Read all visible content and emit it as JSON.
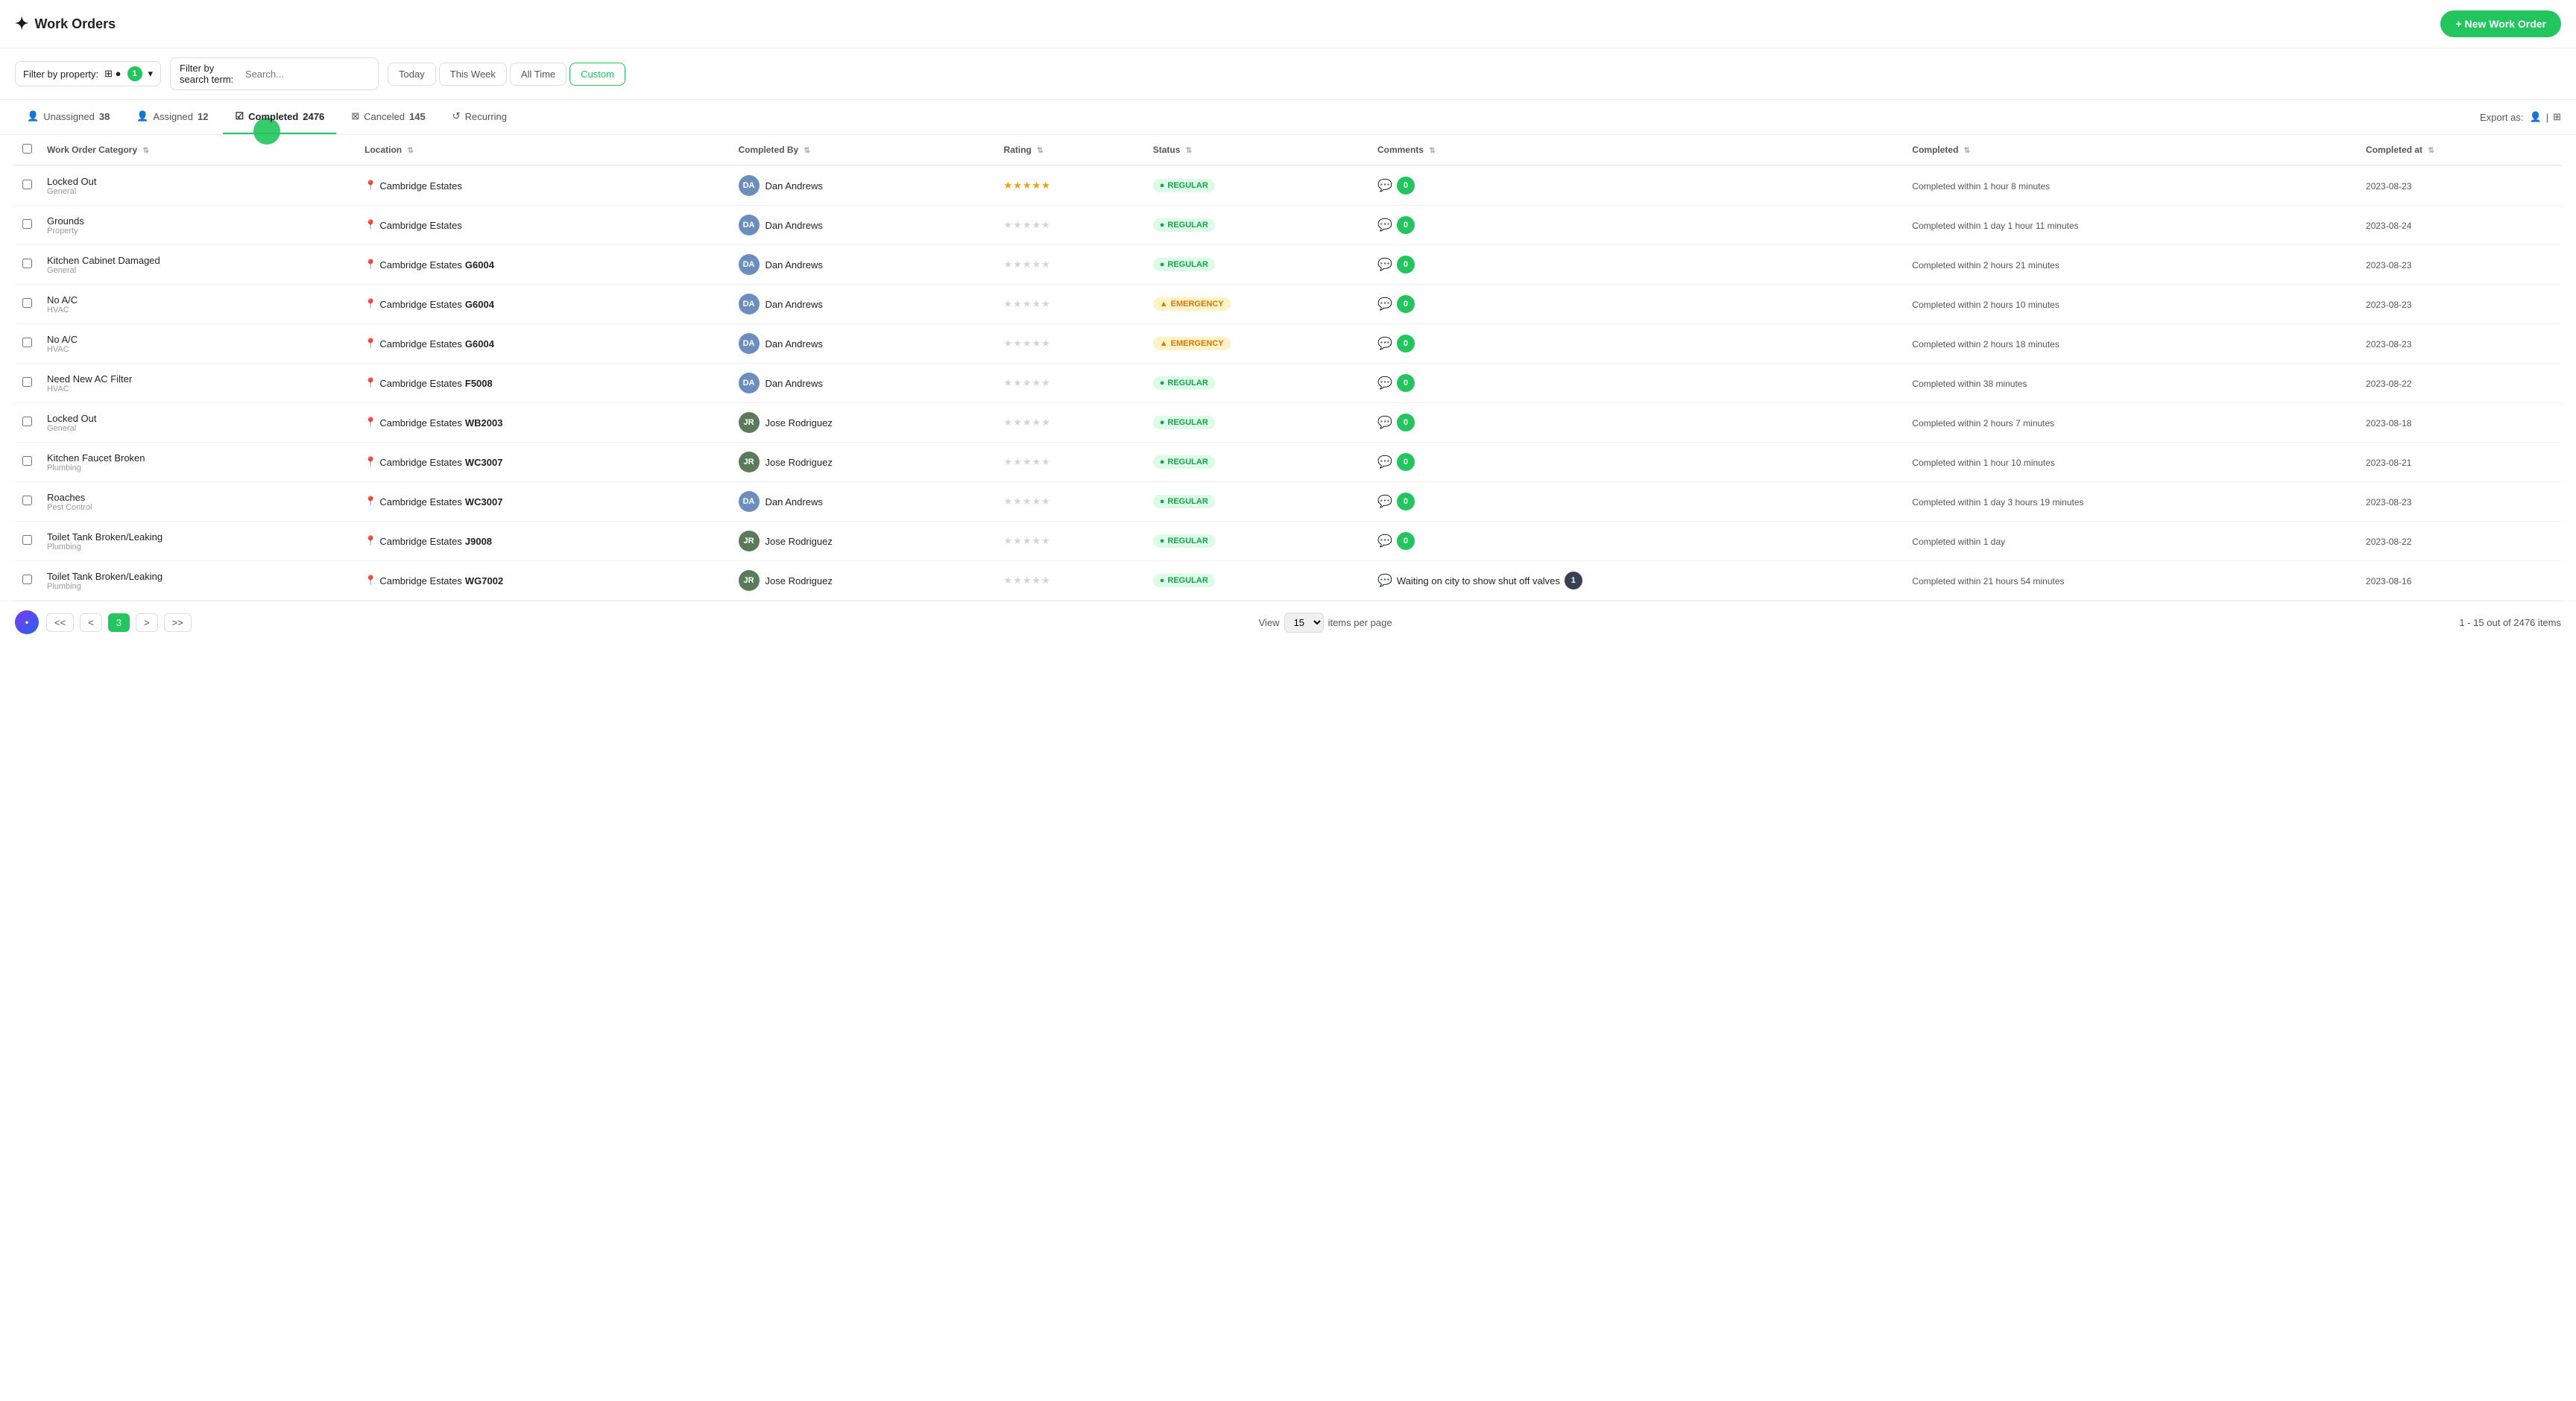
{
  "app": {
    "title": "Work Orders",
    "new_work_order_btn": "+ New Work Order"
  },
  "filter_bar": {
    "filter_property_label": "Filter by property:",
    "filter_count": "1",
    "search_label": "Filter by search term:",
    "search_placeholder": "Search...",
    "date_filters": [
      {
        "label": "Today",
        "active": false
      },
      {
        "label": "This Week",
        "active": false
      },
      {
        "label": "All Time",
        "active": false
      },
      {
        "label": "Custom",
        "active": true
      }
    ]
  },
  "tabs": [
    {
      "label": "Unassigned",
      "count": "38",
      "icon": "person"
    },
    {
      "label": "Assigned",
      "count": "12",
      "icon": "person"
    },
    {
      "label": "Completed",
      "count": "2476",
      "icon": "check",
      "active": true
    },
    {
      "label": "Canceled",
      "count": "145",
      "icon": "x"
    },
    {
      "label": "Recurring",
      "count": "",
      "icon": "refresh"
    }
  ],
  "export": {
    "label": "Export as:"
  },
  "table": {
    "columns": [
      {
        "label": "Work Order Category",
        "sortable": true
      },
      {
        "label": "Location",
        "sortable": true
      },
      {
        "label": "Completed By",
        "sortable": true
      },
      {
        "label": "Rating",
        "sortable": true
      },
      {
        "label": "Status",
        "sortable": true
      },
      {
        "label": "Comments",
        "sortable": true
      },
      {
        "label": "Completed",
        "sortable": true
      },
      {
        "label": "Completed at",
        "sortable": true
      }
    ],
    "rows": [
      {
        "category": "Locked Out",
        "subcategory": "General",
        "location": "Cambridge Estates",
        "location_unit": "",
        "completed_by": "Dan Andrews",
        "avatar_initials": "DA",
        "avatar_class": "avatar-da",
        "rating": 5,
        "status": "REGULAR",
        "status_type": "regular",
        "comment_count": "0",
        "comment_has_text": false,
        "completed": "Completed within 1 hour 8 minutes",
        "completed_at": "2023-08-23"
      },
      {
        "category": "Grounds",
        "subcategory": "Property",
        "location": "Cambridge Estates",
        "location_unit": "",
        "completed_by": "Dan Andrews",
        "avatar_initials": "DA",
        "avatar_class": "avatar-da",
        "rating": 0,
        "status": "REGULAR",
        "status_type": "regular",
        "comment_count": "0",
        "comment_has_text": false,
        "completed": "Completed within 1 day 1 hour 11 minutes",
        "completed_at": "2023-08-24"
      },
      {
        "category": "Kitchen Cabinet Damaged",
        "subcategory": "General",
        "location": "Cambridge Estates",
        "location_unit": "G6004",
        "completed_by": "Dan Andrews",
        "avatar_initials": "DA",
        "avatar_class": "avatar-da",
        "rating": 0,
        "status": "REGULAR",
        "status_type": "regular",
        "comment_count": "0",
        "comment_has_text": false,
        "completed": "Completed within 2 hours 21 minutes",
        "completed_at": "2023-08-23"
      },
      {
        "category": "No A/C",
        "subcategory": "HVAC",
        "location": "Cambridge Estates",
        "location_unit": "G6004",
        "completed_by": "Dan Andrews",
        "avatar_initials": "DA",
        "avatar_class": "avatar-da",
        "rating": 0,
        "status": "EMERGENCY",
        "status_type": "emergency",
        "comment_count": "0",
        "comment_has_text": false,
        "completed": "Completed within 2 hours 10 minutes",
        "completed_at": "2023-08-23"
      },
      {
        "category": "No A/C",
        "subcategory": "HVAC",
        "location": "Cambridge Estates",
        "location_unit": "G6004",
        "completed_by": "Dan Andrews",
        "avatar_initials": "DA",
        "avatar_class": "avatar-da",
        "rating": 0,
        "status": "EMERGENCY",
        "status_type": "emergency",
        "comment_count": "0",
        "comment_has_text": false,
        "completed": "Completed within 2 hours 18 minutes",
        "completed_at": "2023-08-23"
      },
      {
        "category": "Need New AC Filter",
        "subcategory": "HVAC",
        "location": "Cambridge Estates",
        "location_unit": "F5008",
        "completed_by": "Dan Andrews",
        "avatar_initials": "DA",
        "avatar_class": "avatar-da",
        "rating": 0,
        "status": "REGULAR",
        "status_type": "regular",
        "comment_count": "0",
        "comment_has_text": false,
        "completed": "Completed within 38 minutes",
        "completed_at": "2023-08-22"
      },
      {
        "category": "Locked Out",
        "subcategory": "General",
        "location": "Cambridge Estates",
        "location_unit": "WB2003",
        "completed_by": "Jose Rodriguez",
        "avatar_initials": "JR",
        "avatar_class": "avatar-jr",
        "rating": 0,
        "status": "REGULAR",
        "status_type": "regular",
        "comment_count": "0",
        "comment_has_text": false,
        "completed": "Completed within 2 hours 7 minutes",
        "completed_at": "2023-08-18"
      },
      {
        "category": "Kitchen Faucet Broken",
        "subcategory": "Plumbing",
        "location": "Cambridge Estates",
        "location_unit": "WC3007",
        "completed_by": "Jose Rodriguez",
        "avatar_initials": "JR",
        "avatar_class": "avatar-jr",
        "rating": 0,
        "status": "REGULAR",
        "status_type": "regular",
        "comment_count": "0",
        "comment_has_text": false,
        "completed": "Completed within 1 hour 10 minutes",
        "completed_at": "2023-08-21"
      },
      {
        "category": "Roaches",
        "subcategory": "Pest Control",
        "location": "Cambridge Estates",
        "location_unit": "WC3007",
        "completed_by": "Dan Andrews",
        "avatar_initials": "DA",
        "avatar_class": "avatar-da",
        "rating": 0,
        "status": "REGULAR",
        "status_type": "regular",
        "comment_count": "0",
        "comment_has_text": false,
        "completed": "Completed within 1 day 3 hours 19 minutes",
        "completed_at": "2023-08-23"
      },
      {
        "category": "Toilet Tank Broken/Leaking",
        "subcategory": "Plumbing",
        "location": "Cambridge Estates",
        "location_unit": "J9008",
        "completed_by": "Jose Rodriguez",
        "avatar_initials": "JR",
        "avatar_class": "avatar-jr",
        "rating": 0,
        "status": "REGULAR",
        "status_type": "regular",
        "comment_count": "0",
        "comment_has_text": false,
        "completed": "Completed within 1 day",
        "completed_at": "2023-08-22"
      },
      {
        "category": "Toilet Tank Broken/Leaking",
        "subcategory": "Plumbing",
        "location": "Cambridge Estates",
        "location_unit": "WG7002",
        "completed_by": "Jose Rodriguez",
        "avatar_initials": "JR",
        "avatar_class": "avatar-jr",
        "rating": 0,
        "status": "REGULAR",
        "status_type": "regular",
        "comment_count": "1",
        "comment_has_text": true,
        "comment_text": "Waiting on city to show shut off valves",
        "completed": "Completed within 21 hours 54 minutes",
        "completed_at": "2023-08-16"
      }
    ]
  },
  "pagination": {
    "view_label": "View",
    "items_per_page": "15",
    "items_per_page_label": "items per page",
    "summary": "1 - 15 out of 2476 items",
    "page_numbers": [
      "<",
      "3",
      ">",
      ">>"
    ]
  }
}
